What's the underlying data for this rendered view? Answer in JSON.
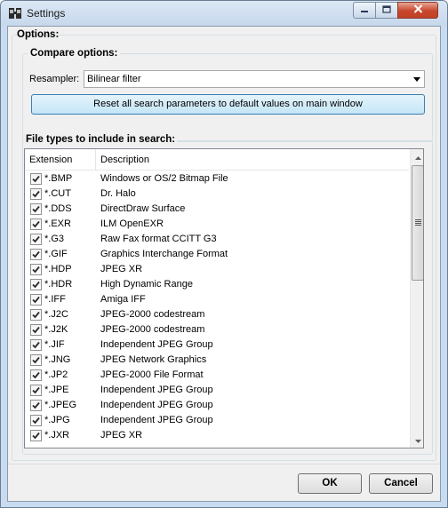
{
  "window": {
    "title": "Settings"
  },
  "options": {
    "title": "Options:",
    "compare": {
      "title": "Compare options:",
      "resampler_label": "Resampler:",
      "resampler_value": "Bilinear filter",
      "reset_button": "Reset all search parameters to default values on main window"
    },
    "file_types": {
      "title": "File types to include in search:",
      "columns": [
        "Extension",
        "Description"
      ],
      "rows": [
        {
          "ext": "*.BMP",
          "desc": "Windows or OS/2 Bitmap File",
          "checked": true
        },
        {
          "ext": "*.CUT",
          "desc": "Dr. Halo",
          "checked": true
        },
        {
          "ext": "*.DDS",
          "desc": "DirectDraw Surface",
          "checked": true
        },
        {
          "ext": "*.EXR",
          "desc": "ILM OpenEXR",
          "checked": true
        },
        {
          "ext": "*.G3",
          "desc": "Raw Fax format CCITT G3",
          "checked": true
        },
        {
          "ext": "*.GIF",
          "desc": "Graphics Interchange Format",
          "checked": true
        },
        {
          "ext": "*.HDP",
          "desc": "JPEG XR",
          "checked": true
        },
        {
          "ext": "*.HDR",
          "desc": "High Dynamic Range",
          "checked": true
        },
        {
          "ext": "*.IFF",
          "desc": "Amiga IFF",
          "checked": true
        },
        {
          "ext": "*.J2C",
          "desc": "JPEG-2000 codestream",
          "checked": true
        },
        {
          "ext": "*.J2K",
          "desc": "JPEG-2000 codestream",
          "checked": true
        },
        {
          "ext": "*.JIF",
          "desc": "Independent JPEG Group",
          "checked": true
        },
        {
          "ext": "*.JNG",
          "desc": "JPEG Network Graphics",
          "checked": true
        },
        {
          "ext": "*.JP2",
          "desc": "JPEG-2000 File Format",
          "checked": true
        },
        {
          "ext": "*.JPE",
          "desc": "Independent JPEG Group",
          "checked": true
        },
        {
          "ext": "*.JPEG",
          "desc": "Independent JPEG Group",
          "checked": true
        },
        {
          "ext": "*.JPG",
          "desc": "Independent JPEG Group",
          "checked": true
        },
        {
          "ext": "*.JXR",
          "desc": "JPEG XR",
          "checked": true
        }
      ]
    }
  },
  "buttons": {
    "ok": "OK",
    "cancel": "Cancel"
  },
  "icons": {
    "app": "settings-app-icon",
    "minimize": "minimize-icon",
    "maximize": "maximize-icon",
    "close": "close-icon",
    "dropdown": "chevron-down-icon",
    "check": "check-icon",
    "scroll_up": "scroll-up-arrow-icon",
    "scroll_down": "scroll-down-arrow-icon"
  },
  "colors": {
    "close_button": "#c7462c",
    "reset_button": "#c4e5f6",
    "checkbox_mark": "#2a2a2a"
  }
}
